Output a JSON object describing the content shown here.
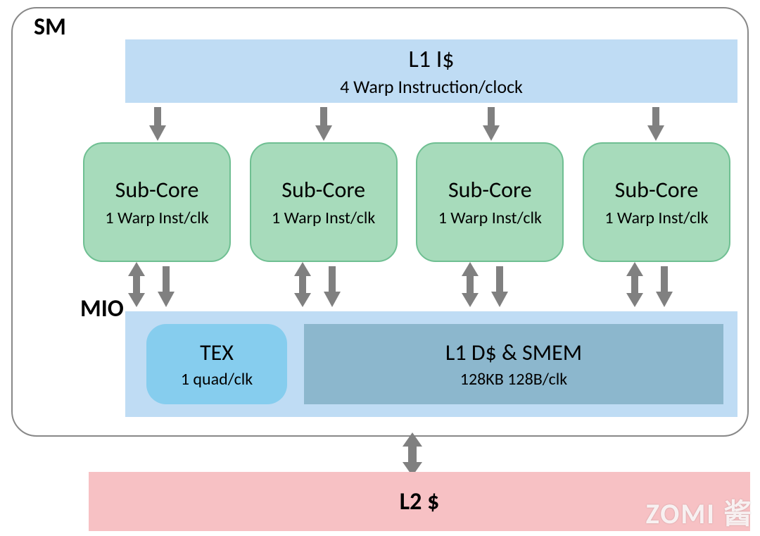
{
  "sm_label": "SM",
  "l1i": {
    "title": "L1 I$",
    "sub": "4 Warp Instruction/clock"
  },
  "subcores": [
    {
      "title": "Sub-Core",
      "sub": "1 Warp Inst/clk"
    },
    {
      "title": "Sub-Core",
      "sub": "1 Warp Inst/clk"
    },
    {
      "title": "Sub-Core",
      "sub": "1 Warp Inst/clk"
    },
    {
      "title": "Sub-Core",
      "sub": "1 Warp Inst/clk"
    }
  ],
  "mio_label": "MIO",
  "tex": {
    "title": "TEX",
    "sub": "1 quad/clk"
  },
  "l1d": {
    "title": "L1 D$ & SMEM",
    "sub": "128KB 128B/clk"
  },
  "l2": "L2 $",
  "watermark": "ZOMI 酱",
  "colors": {
    "lightblue": "#bfdcf4",
    "green": "#a7dbbb",
    "midblue": "#86cdee",
    "steelblue": "#8cb7cd",
    "pink": "#f7c1c4",
    "arrow": "#808080"
  }
}
